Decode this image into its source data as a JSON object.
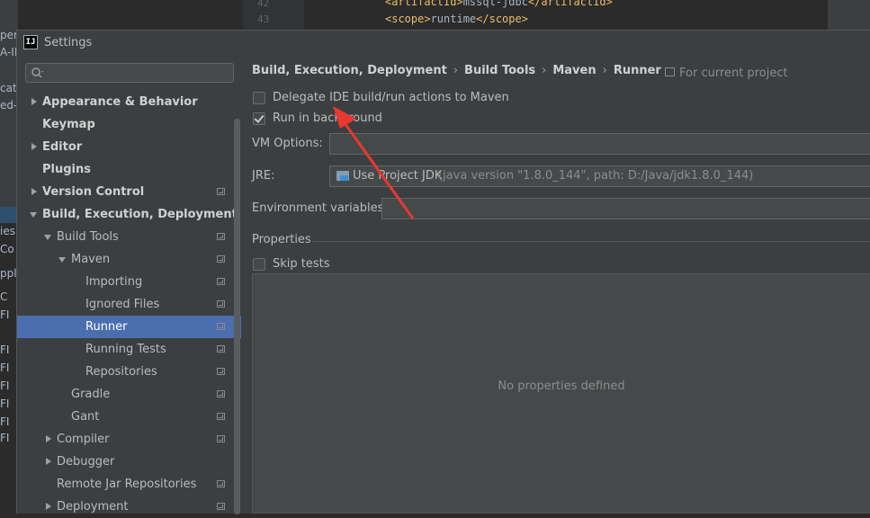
{
  "background": {
    "left_fragments": [
      "per",
      "A-IN",
      "cati",
      "ed-",
      "ies",
      "Co",
      "ppl",
      "C",
      "FI",
      "FI",
      "FI",
      "FI",
      "FI",
      "FI",
      "FI"
    ],
    "line_numbers": [
      "42",
      "43"
    ],
    "code_lines": [
      {
        "open": "<artifactId>",
        "text": "mssql-jdbc",
        "close": "</artifactId>"
      },
      {
        "open": "<scope>",
        "text": "runtime",
        "close": "</scope>"
      }
    ]
  },
  "dialog": {
    "app_icon": "intellij-icon",
    "title": "Settings"
  },
  "sidebar": {
    "search": {
      "value": "",
      "placeholder": "",
      "icon": "search-icon"
    },
    "items": [
      {
        "label": "Appearance & Behavior",
        "bold": true,
        "arrow": "right",
        "indent": 0,
        "proj": false
      },
      {
        "label": "Keymap",
        "bold": true,
        "arrow": "none",
        "indent": 0,
        "proj": false
      },
      {
        "label": "Editor",
        "bold": true,
        "arrow": "right",
        "indent": 0,
        "proj": false
      },
      {
        "label": "Plugins",
        "bold": true,
        "arrow": "none",
        "indent": 0,
        "proj": false
      },
      {
        "label": "Version Control",
        "bold": true,
        "arrow": "right",
        "indent": 0,
        "proj": true
      },
      {
        "label": "Build, Execution, Deployment",
        "bold": true,
        "arrow": "down",
        "indent": 0,
        "proj": false
      },
      {
        "label": "Build Tools",
        "bold": false,
        "arrow": "down",
        "indent": 1,
        "proj": true
      },
      {
        "label": "Maven",
        "bold": false,
        "arrow": "down",
        "indent": 2,
        "proj": true
      },
      {
        "label": "Importing",
        "bold": false,
        "arrow": "none",
        "indent": 3,
        "proj": true
      },
      {
        "label": "Ignored Files",
        "bold": false,
        "arrow": "none",
        "indent": 3,
        "proj": true
      },
      {
        "label": "Runner",
        "bold": false,
        "arrow": "none",
        "indent": 3,
        "proj": true,
        "selected": true
      },
      {
        "label": "Running Tests",
        "bold": false,
        "arrow": "none",
        "indent": 3,
        "proj": true
      },
      {
        "label": "Repositories",
        "bold": false,
        "arrow": "none",
        "indent": 3,
        "proj": true
      },
      {
        "label": "Gradle",
        "bold": false,
        "arrow": "none",
        "indent": 2,
        "proj": true
      },
      {
        "label": "Gant",
        "bold": false,
        "arrow": "none",
        "indent": 2,
        "proj": true
      },
      {
        "label": "Compiler",
        "bold": false,
        "arrow": "right",
        "indent": 1,
        "proj": true
      },
      {
        "label": "Debugger",
        "bold": false,
        "arrow": "right",
        "indent": 1,
        "proj": false
      },
      {
        "label": "Remote Jar Repositories",
        "bold": false,
        "arrow": "none",
        "indent": 1,
        "proj": true
      },
      {
        "label": "Deployment",
        "bold": false,
        "arrow": "right",
        "indent": 1,
        "proj": true
      }
    ]
  },
  "main": {
    "breadcrumb": [
      "Build, Execution, Deployment",
      "Build Tools",
      "Maven",
      "Runner"
    ],
    "breadcrumb_separator": "›",
    "for_project": "For current project",
    "delegate_checkbox": {
      "label": "Delegate IDE build/run actions to Maven",
      "checked": false
    },
    "background_checkbox": {
      "label": "Run in background",
      "checked": true
    },
    "vm_options": {
      "label": "VM Options:",
      "value": ""
    },
    "jre": {
      "label": "JRE:",
      "value_main": "Use Project JDK",
      "value_detail": "(java version \"1.8.0_144\", path: D:/Java/jdk1.8.0_144)",
      "icon": "folder-icon"
    },
    "env_vars": {
      "label": "Environment variables:",
      "value": ""
    },
    "properties_header": "Properties",
    "skip_tests": {
      "label": "Skip tests",
      "checked": false
    },
    "no_properties": "No properties defined"
  },
  "colors": {
    "selection": "#4b6eaf",
    "annotation_arrow": "#e8382f"
  }
}
